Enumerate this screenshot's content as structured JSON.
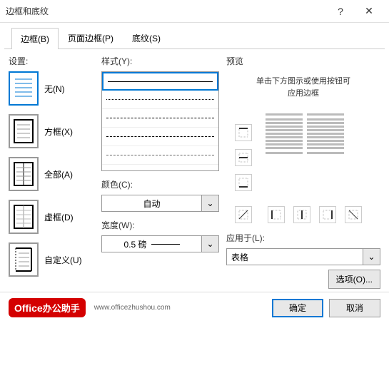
{
  "titlebar": {
    "title": "边框和底纹"
  },
  "tabs": [
    {
      "label": "边框(B)",
      "key": "B"
    },
    {
      "label": "页面边框(P)",
      "key": "P"
    },
    {
      "label": "底纹(S)",
      "key": "S"
    }
  ],
  "settings": {
    "label": "设置:",
    "items": [
      {
        "label": "无(N)",
        "key": "N"
      },
      {
        "label": "方框(X)",
        "key": "X"
      },
      {
        "label": "全部(A)",
        "key": "A"
      },
      {
        "label": "虚框(D)",
        "key": "D"
      },
      {
        "label": "自定义(U)",
        "key": "U"
      }
    ]
  },
  "style": {
    "label": "样式(Y):"
  },
  "color": {
    "label": "颜色(C):",
    "value": "自动"
  },
  "width": {
    "label": "宽度(W):",
    "value": "0.5 磅"
  },
  "preview": {
    "label": "预览",
    "hint_line1": "单击下方图示或使用按钮可",
    "hint_line2": "应用边框"
  },
  "apply": {
    "label": "应用于(L):",
    "value": "表格"
  },
  "options": {
    "label": "选项(O)..."
  },
  "footer": {
    "brand_en": "Office",
    "brand_cn": "办公助手",
    "url": "www.officezhushou.com",
    "ok": "确定",
    "cancel": "取消"
  }
}
